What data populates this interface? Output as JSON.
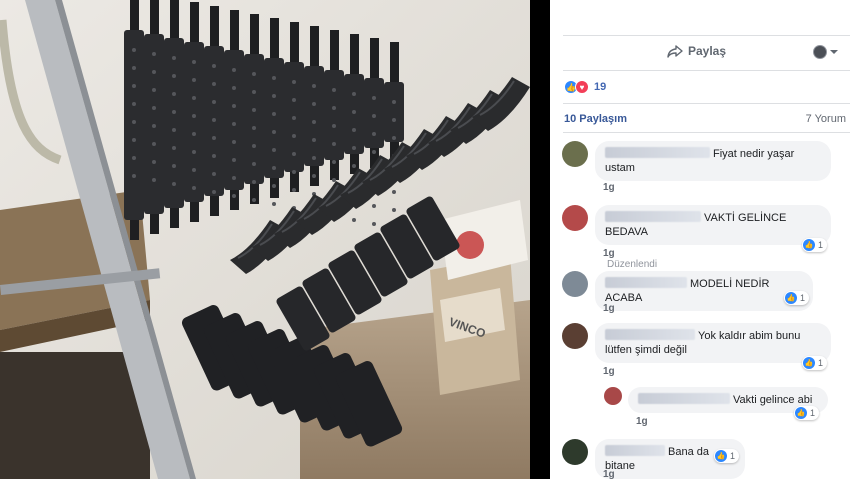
{
  "photo": {
    "alt_brand": "VINCO"
  },
  "post": {
    "share_label": "Paylaş",
    "reactions_count": "19",
    "shares_label": "10 Paylaşım",
    "comments_label": "7 Yorum"
  },
  "colors": {
    "link": "#385898",
    "like": "#2d88ff",
    "love": "#f33e58",
    "bubble": "#f2f3f5"
  },
  "comments": [
    {
      "text": "Fiyat nedir yaşar",
      "text2": "ustam",
      "time": "1g",
      "edited": "",
      "likes": ""
    },
    {
      "text": "VAKTİ GELİNCE",
      "text2": "BEDAVA",
      "time": "1g",
      "edited": "Düzenlendi",
      "likes": "1"
    },
    {
      "text": "MODELİ NEDİR ACABA",
      "text2": "",
      "time": "1g",
      "edited": "",
      "likes": "1"
    },
    {
      "text": "Yok kaldır abim bunu",
      "text2": "lütfen şimdi değil",
      "time": "1g",
      "edited": "",
      "likes": "1"
    },
    {
      "text": "Vakti gelince abi",
      "text2": "",
      "time": "1g",
      "edited": "",
      "likes": "1"
    },
    {
      "text": "Bana da bitane",
      "text2": "",
      "time": "1g",
      "edited": "",
      "likes": "1"
    }
  ]
}
